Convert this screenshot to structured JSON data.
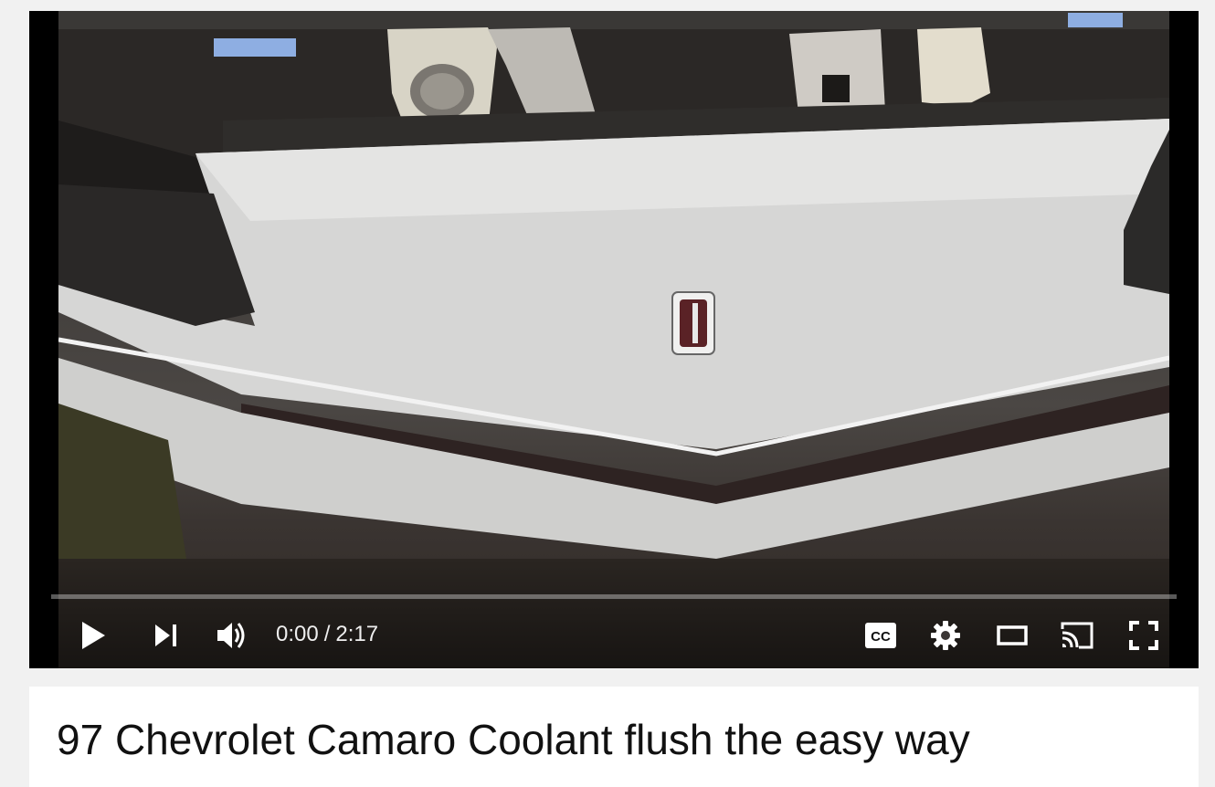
{
  "player": {
    "current_time": "0:00",
    "time_separator": "/",
    "duration": "2:17",
    "progress": 0.0,
    "controls": {
      "play": "play-icon",
      "next": "next-icon",
      "volume": "volume-icon",
      "captions": "cc-icon",
      "settings": "gear-icon",
      "theater": "theater-icon",
      "cast": "cast-icon",
      "fullscreen": "fullscreen-icon"
    },
    "captions_label": "CC"
  },
  "video": {
    "title": "97 Chevrolet Camaro Coolant flush the easy way"
  },
  "colors": {
    "page_background": "#f1f1f1",
    "player_background": "#000000",
    "progress_track": "#9e9e9e",
    "control_icon": "#ffffff",
    "title_text": "#111111"
  }
}
